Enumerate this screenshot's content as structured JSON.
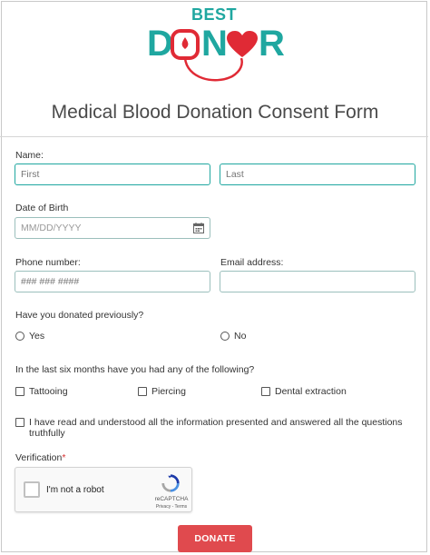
{
  "brand": {
    "top": "BEST",
    "d": "D",
    "o": "O",
    "n": "N",
    "r": "R",
    "teal": "#1fa7a0",
    "red": "#e02a35"
  },
  "form": {
    "title": "Medical Blood Donation Consent Form",
    "name_label": "Name:",
    "first_placeholder": "First",
    "last_placeholder": "Last",
    "dob_label": "Date of Birth",
    "dob_placeholder": "MM/DD/YYYY",
    "phone_label": "Phone number:",
    "phone_placeholder": "### ### ####",
    "email_label": "Email address:",
    "donated_question": "Have you donated previously?",
    "donated_options": [
      "Yes",
      "No"
    ],
    "six_months_question": "In the last six months have you had any of the following?",
    "six_months_options": [
      "Tattooing",
      "Piercing",
      "Dental extraction"
    ],
    "agreement_line1": "I have read and understood all the information presented and answered all the questions",
    "agreement_line2": "truthfully",
    "verification_label": "Verification",
    "required_mark": "*",
    "captcha_text": "I'm not a robot",
    "captcha_brand": "reCAPTCHA",
    "captcha_links": "Privacy - Terms",
    "submit_label": "DONATE"
  }
}
